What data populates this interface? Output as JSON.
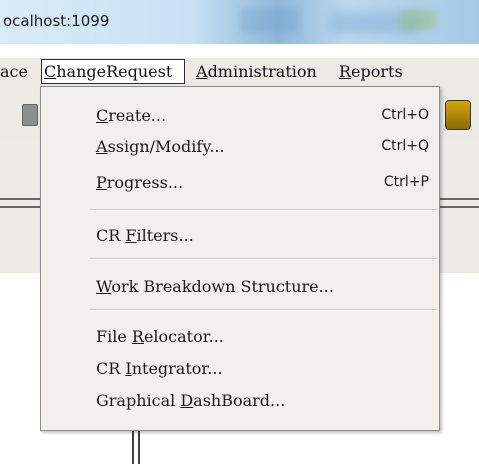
{
  "window": {
    "title": "ocalhost:1099"
  },
  "menubar": {
    "items": [
      {
        "label": "ace",
        "mnemonic_prefix": "",
        "mnemonic": "",
        "rest": "ace"
      },
      {
        "label": "ChangeRequest",
        "mnemonic_prefix": "",
        "mnemonic": "C",
        "rest": "hangeRequest"
      },
      {
        "label": "Administration",
        "mnemonic_prefix": "",
        "mnemonic": "A",
        "rest": "dministration"
      },
      {
        "label": "Reports",
        "mnemonic_prefix": "",
        "mnemonic": "R",
        "rest": "eports"
      }
    ]
  },
  "dropdown": {
    "items": [
      {
        "label": "Create...",
        "pre": "",
        "mn": "C",
        "post": "reate...",
        "shortcut": "Ctrl+O"
      },
      {
        "label": "Assign/Modify...",
        "pre": "",
        "mn": "A",
        "post": "ssign/Modify...",
        "shortcut": "Ctrl+Q"
      },
      {
        "label": "Progress...",
        "pre": "",
        "mn": "P",
        "post": "rogress...",
        "shortcut": "Ctrl+P"
      },
      {
        "label": "CR Filters...",
        "pre": "CR ",
        "mn": "F",
        "post": "ilters...",
        "shortcut": ""
      },
      {
        "label": "Work Breakdown Structure...",
        "pre": "",
        "mn": "W",
        "post": "ork Breakdown Structure...",
        "shortcut": ""
      },
      {
        "label": "File Relocator...",
        "pre": "File ",
        "mn": "R",
        "post": "elocator...",
        "shortcut": ""
      },
      {
        "label": "CR Integrator...",
        "pre": "CR ",
        "mn": "I",
        "post": "ntegrator...",
        "shortcut": ""
      },
      {
        "label": "Graphical DashBoard...",
        "pre": "Graphical ",
        "mn": "D",
        "post": "ashBoard...",
        "shortcut": ""
      }
    ]
  },
  "icons": {
    "toolbar_left": "toolbar-button-icon",
    "toolbar_right": "database-icon"
  },
  "colors": {
    "menubar_bg": "#ebeae5",
    "menu_bg": "#f1f0ec",
    "titlebar": "#c8e1f3"
  }
}
